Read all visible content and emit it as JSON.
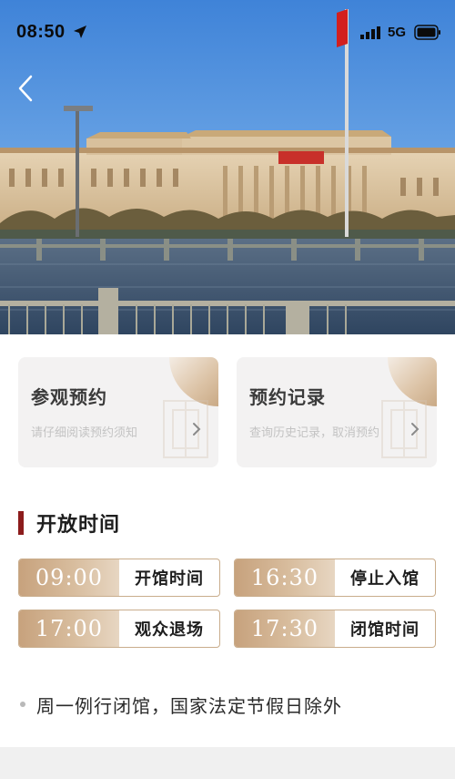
{
  "status_bar": {
    "time": "08:50",
    "network": "5G",
    "icons": [
      "location-arrow-icon",
      "signal-icon",
      "battery-icon"
    ]
  },
  "nav": {
    "back_icon": "chevron-left-icon"
  },
  "cards": [
    {
      "title": "参观预约",
      "subtitle": "请仔细阅读预约须知",
      "icon": "chevron-right-icon"
    },
    {
      "title": "预约记录",
      "subtitle": "查询历史记录，取消预约",
      "icon": "chevron-right-icon"
    }
  ],
  "hours": {
    "title": "开放时间",
    "items": [
      {
        "time": "09:00",
        "label": "开馆时间"
      },
      {
        "time": "16:30",
        "label": "停止入馆"
      },
      {
        "time": "17:00",
        "label": "观众退场"
      },
      {
        "time": "17:30",
        "label": "闭馆时间"
      }
    ],
    "note": "周一例行闭馆，国家法定节假日除外"
  },
  "colors": {
    "accent_red": "#8c1c1c",
    "gold": "#c7a27d",
    "card_bg": "#f3f2f2"
  }
}
